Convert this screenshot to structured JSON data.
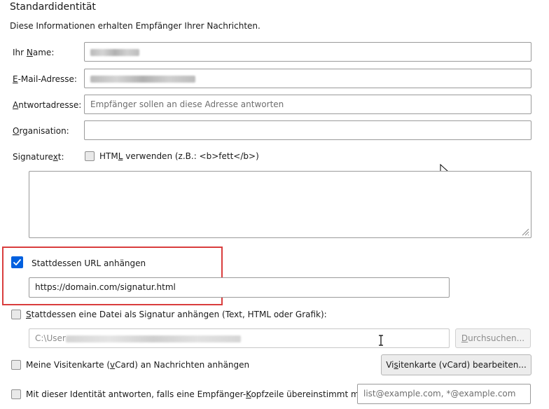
{
  "section": {
    "title": "Standardidentität",
    "subtitle": "Diese Informationen erhalten Empfänger Ihrer Nachrichten."
  },
  "fields": {
    "name": {
      "pre": "Ihr ",
      "key": "N",
      "post": "ame:"
    },
    "email": {
      "key": "E",
      "post": "-Mail-Adresse:"
    },
    "reply": {
      "key": "A",
      "post": "ntwortadresse:",
      "placeholder": "Empfänger sollen an diese Adresse antworten"
    },
    "org": {
      "key": "O",
      "post": "rganisation:"
    },
    "signature": {
      "pre": "Signature",
      "key": "x",
      "post": "t:"
    }
  },
  "html_option": {
    "pre": "HTM",
    "key": "L",
    "post": " verwenden (z.B.: <b>fett</b>)"
  },
  "url_option": {
    "label": "Stattdessen URL anhängen",
    "value": "https://domain.com/signatur.html",
    "checked": true
  },
  "file_option": {
    "key": "S",
    "post": "tattdessen eine Datei als Signatur anhängen (Text, HTML oder Grafik):",
    "path_prefix": "C:\\User",
    "browse": {
      "key": "D",
      "post": "urchsuchen..."
    }
  },
  "vcard_option": {
    "pre": "Meine Visitenkarte (",
    "key": "v",
    "post": "Card) an Nachrichten anhängen",
    "button": {
      "pre": "Vi",
      "key": "s",
      "post": "itenkarte (vCard) bearbeiten..."
    }
  },
  "reply_identity": {
    "pre": "Mit dieser Identität antworten, falls eine Empfänger-",
    "key": "K",
    "post": "opfzeile übereinstimmt mit:",
    "placeholder": "list@example.com, *@example.com"
  },
  "icons": {
    "check": "checkmark-icon",
    "resize": "resize-grip-icon",
    "cursor": "mouse-cursor-icon",
    "ibeam": "text-cursor-icon"
  },
  "colors": {
    "accent": "#0060df",
    "highlight": "#d93d3d"
  }
}
